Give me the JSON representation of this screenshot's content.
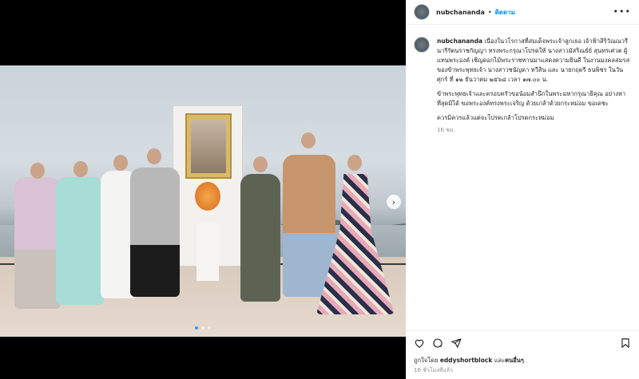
{
  "post": {
    "username": "nubchananda",
    "follow_label": "ติดตาม",
    "separator": "•",
    "more_label": "•••",
    "caption_username": "nubchananda",
    "caption_p1": "เนื่องในวโรกาสที่สมเด็จพระเจ้าลูกเธอ เจ้าฟ้าสิริวัณณวรี นารีรัตนราชกัญญา ทรงพระกรุณาโปรดให้ นางสาวมัสริณย์ย์ สุนทรเศวต ผู้แทนพระองค์ เชิญดอกไม้พระราชทานมาแสดงความยินดี ในงานมงคลสมรสของข้าพระพุทธเจ้า นางสาวชนัญดา ทวีสิน และ นายกฤดรี ธนพิชร ในวันศุกร์ ที่ ๑๒ ธันวาคม ๒๕๖๘ เวลา ๑๗.๐๐ น.",
    "caption_p2": "ข้าพระพุทธเจ้าและครอบครัวขอน้อมสำนึกในพระมหากรุณาธิคุณ อย่างหาที่สุดมิได้ ขอพระองค์ทรงพระเจริญ ด้วยเกล้าด้วยกระหม่อม ขอเดชะ",
    "caption_p3": "ควรมิควรแล้วแต่จะโปรดเกล้าโปรดกระหม่อม",
    "caption_time": "16 ชม.",
    "liked_by_prefix": "ถูกใจโดย ",
    "liked_by_user": "eddyshortblock",
    "liked_by_suffix": " และ",
    "liked_by_others": "คนอื่นๆ",
    "timestamp": "16 ชั่วโมงที่แล้ว",
    "next_icon": "›"
  },
  "icons": [
    "heart-icon",
    "comment-icon",
    "share-icon",
    "bookmark-icon",
    "chevron-right-icon",
    "more-icon"
  ],
  "colors": {
    "link": "#0095f6",
    "text": "#262626",
    "muted": "#8e8e8e"
  }
}
